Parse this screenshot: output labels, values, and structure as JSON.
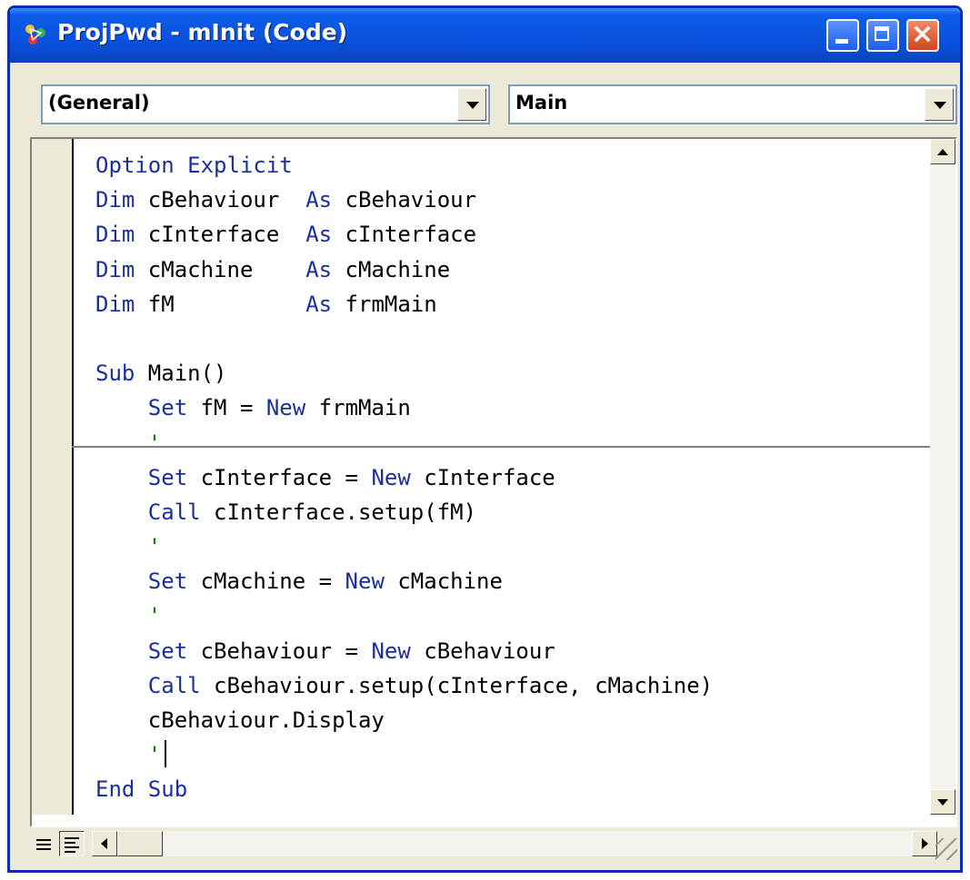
{
  "window": {
    "title": "ProjPwd - mInit (Code)"
  },
  "toolbar": {
    "object_combo": "(General)",
    "procedure_combo": "Main"
  },
  "code": {
    "lines": [
      [
        {
          "t": "Option Explicit",
          "k": "kw"
        }
      ],
      [
        {
          "t": "Dim",
          "k": "kw"
        },
        {
          "t": " cBehaviour  ",
          "k": ""
        },
        {
          "t": "As",
          "k": "kw"
        },
        {
          "t": " cBehaviour",
          "k": ""
        }
      ],
      [
        {
          "t": "Dim",
          "k": "kw"
        },
        {
          "t": " cInterface  ",
          "k": ""
        },
        {
          "t": "As",
          "k": "kw"
        },
        {
          "t": " cInterface",
          "k": ""
        }
      ],
      [
        {
          "t": "Dim",
          "k": "kw"
        },
        {
          "t": " cMachine    ",
          "k": ""
        },
        {
          "t": "As",
          "k": "kw"
        },
        {
          "t": " cMachine",
          "k": ""
        }
      ],
      [
        {
          "t": "Dim",
          "k": "kw"
        },
        {
          "t": " fM          ",
          "k": ""
        },
        {
          "t": "As",
          "k": "kw"
        },
        {
          "t": " frmMain",
          "k": ""
        }
      ],
      [],
      [
        {
          "t": "Sub",
          "k": "kw"
        },
        {
          "t": " Main()",
          "k": ""
        }
      ],
      [
        {
          "t": "    ",
          "k": ""
        },
        {
          "t": "Set",
          "k": "kw"
        },
        {
          "t": " fM = ",
          "k": ""
        },
        {
          "t": "New",
          "k": "kw"
        },
        {
          "t": " frmMain",
          "k": ""
        }
      ],
      [
        {
          "t": "    '",
          "k": "cm"
        }
      ],
      [
        {
          "t": "    ",
          "k": ""
        },
        {
          "t": "Set",
          "k": "kw"
        },
        {
          "t": " cInterface = ",
          "k": ""
        },
        {
          "t": "New",
          "k": "kw"
        },
        {
          "t": " cInterface",
          "k": ""
        }
      ],
      [
        {
          "t": "    ",
          "k": ""
        },
        {
          "t": "Call",
          "k": "kw"
        },
        {
          "t": " cInterface.setup(fM)",
          "k": ""
        }
      ],
      [
        {
          "t": "    '",
          "k": "cm"
        }
      ],
      [
        {
          "t": "    ",
          "k": ""
        },
        {
          "t": "Set",
          "k": "kw"
        },
        {
          "t": " cMachine = ",
          "k": ""
        },
        {
          "t": "New",
          "k": "kw"
        },
        {
          "t": " cMachine",
          "k": ""
        }
      ],
      [
        {
          "t": "    '",
          "k": "cm"
        }
      ],
      [
        {
          "t": "    ",
          "k": ""
        },
        {
          "t": "Set",
          "k": "kw"
        },
        {
          "t": " cBehaviour = ",
          "k": ""
        },
        {
          "t": "New",
          "k": "kw"
        },
        {
          "t": " cBehaviour",
          "k": ""
        }
      ],
      [
        {
          "t": "    ",
          "k": ""
        },
        {
          "t": "Call",
          "k": "kw"
        },
        {
          "t": " cBehaviour.setup(cInterface, cMachine)",
          "k": ""
        }
      ],
      [
        {
          "t": "    cBehaviour.Display",
          "k": ""
        }
      ],
      [
        {
          "t": "    '",
          "k": "cm"
        },
        {
          "caret": true
        }
      ],
      [
        {
          "t": "End Sub",
          "k": "kw"
        }
      ]
    ]
  },
  "icons": {
    "app": "vb-project-icon",
    "minimize": "minimize-icon",
    "maximize": "maximize-icon",
    "close": "close-icon"
  },
  "colors": {
    "keyword": "#1a2f9e",
    "comment": "#008000",
    "titlebar": "#0a53e0"
  }
}
